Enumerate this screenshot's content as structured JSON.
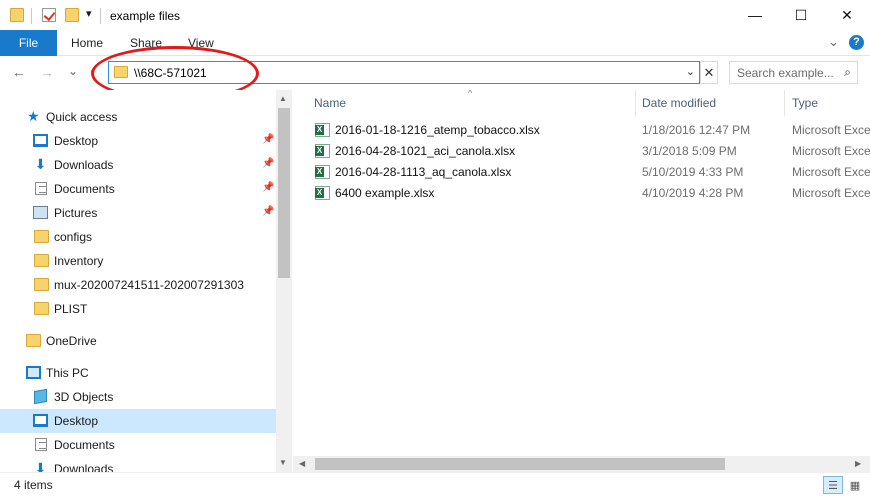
{
  "window": {
    "title": "example files",
    "controls": {
      "minimize": "—",
      "maximize": "☐",
      "close": "✕"
    }
  },
  "quick_access_toolbar": {
    "dropdown": "▾"
  },
  "ribbon": {
    "tabs": [
      "File",
      "Home",
      "Share",
      "View"
    ],
    "expand_glyph": "⌄",
    "help_glyph": "?"
  },
  "navigation": {
    "back": "←",
    "forward": "→",
    "recent": "⌄",
    "up": "↑"
  },
  "address_bar": {
    "path": "\\\\68C-571021",
    "dropdown": "⌄",
    "clear": "✕"
  },
  "search": {
    "placeholder": "Search example...",
    "icon": "⌕"
  },
  "nav_pane": {
    "items": [
      {
        "label": "Quick access",
        "icon": "star-icon",
        "pinned": false,
        "selected": false
      },
      {
        "label": "Desktop",
        "icon": "desktop-icon",
        "pinned": true,
        "selected": false
      },
      {
        "label": "Downloads",
        "icon": "download-icon",
        "pinned": true,
        "selected": false
      },
      {
        "label": "Documents",
        "icon": "documents-icon",
        "pinned": true,
        "selected": false
      },
      {
        "label": "Pictures",
        "icon": "pictures-icon",
        "pinned": true,
        "selected": false
      },
      {
        "label": "configs",
        "icon": "folder-icon",
        "pinned": false,
        "selected": false
      },
      {
        "label": "Inventory",
        "icon": "folder-icon",
        "pinned": false,
        "selected": false
      },
      {
        "label": "mux-202007241511-202007291303",
        "icon": "folder-icon",
        "pinned": false,
        "selected": false
      },
      {
        "label": "PLIST",
        "icon": "folder-icon",
        "pinned": false,
        "selected": false
      },
      {
        "label": "OneDrive",
        "icon": "folder-icon",
        "pinned": false,
        "selected": false
      },
      {
        "label": "This PC",
        "icon": "pc-icon",
        "pinned": false,
        "selected": false
      },
      {
        "label": "3D Objects",
        "icon": "cube-icon",
        "pinned": false,
        "selected": false
      },
      {
        "label": "Desktop",
        "icon": "desktop-icon",
        "pinned": false,
        "selected": true
      },
      {
        "label": "Documents",
        "icon": "documents-icon",
        "pinned": false,
        "selected": false
      },
      {
        "label": "Downloads",
        "icon": "download-icon",
        "pinned": false,
        "selected": false
      }
    ],
    "pin_glyph": "📌"
  },
  "file_list": {
    "columns": {
      "name": "Name",
      "date": "Date modified",
      "type": "Type"
    },
    "sort_glyph": "^",
    "files": [
      {
        "name": "2016-01-18-1216_atemp_tobacco.xlsx",
        "date": "1/18/2016 12:47 PM",
        "type": "Microsoft Excel"
      },
      {
        "name": "2016-04-28-1021_aci_canola.xlsx",
        "date": "3/1/2018 5:09 PM",
        "type": "Microsoft Excel"
      },
      {
        "name": "2016-04-28-1113_aq_canola.xlsx",
        "date": "5/10/2019 4:33 PM",
        "type": "Microsoft Excel"
      },
      {
        "name": "6400 example.xlsx",
        "date": "4/10/2019 4:28 PM",
        "type": "Microsoft Excel"
      }
    ]
  },
  "status_bar": {
    "item_count": "4 items",
    "details_view": "☰",
    "tiles_view": "▦"
  },
  "colors": {
    "accent": "#1979ca",
    "selection": "#cce8ff",
    "annotation": "#e31a1a",
    "excel": "#1e7145"
  }
}
